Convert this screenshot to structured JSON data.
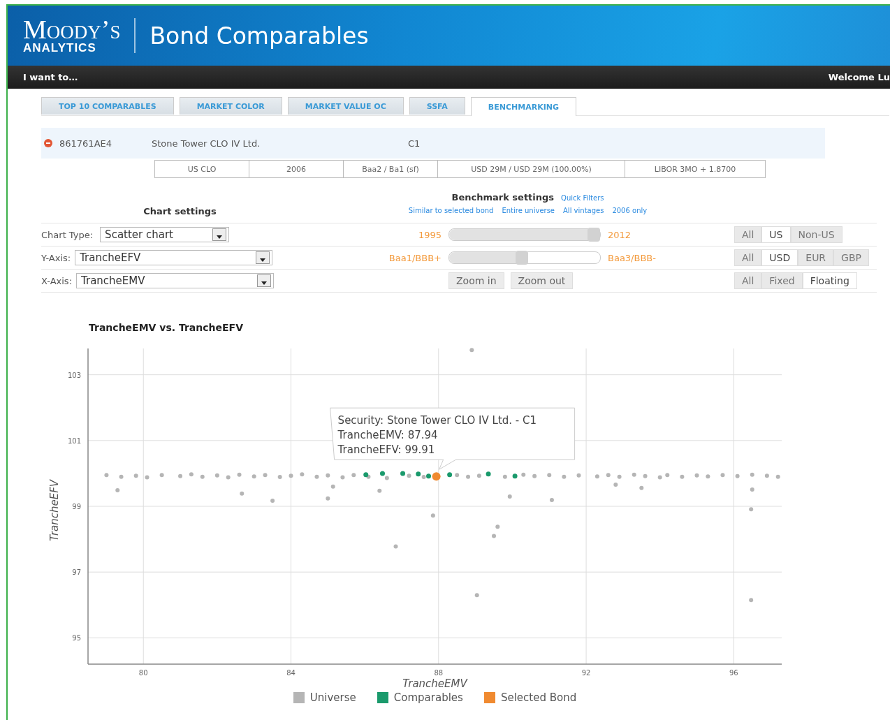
{
  "header": {
    "logo_name": "Moody’s",
    "logo_sub": "ANALYTICS",
    "title": "Bond Comparables"
  },
  "nav_bar": {
    "menu": "I want to…",
    "welcome": "Welcome Lu"
  },
  "tabs": [
    {
      "label": "TOP 10 COMPARABLES",
      "selected": false
    },
    {
      "label": "MARKET COLOR",
      "selected": false
    },
    {
      "label": "MARKET VALUE OC",
      "selected": false
    },
    {
      "label": "SSFA",
      "selected": false
    },
    {
      "label": "BENCHMARKING",
      "selected": true
    }
  ],
  "bond": {
    "cusip": "861761AE4",
    "name": "Stone Tower CLO IV Ltd.",
    "tranche": "C1",
    "details": [
      "US CLO",
      "2006",
      "Baa2 / Ba1 (sf)",
      "USD 29M / USD 29M (100.00%)",
      "LIBOR 3MO + 1.8700"
    ]
  },
  "chart_settings": {
    "heading": "Chart settings",
    "rows": [
      {
        "label": "Chart Type:",
        "value": "Scatter chart"
      },
      {
        "label": "Y-Axis:",
        "value": "TrancheEFV"
      },
      {
        "label": "X-Axis:",
        "value": "TrancheEMV"
      }
    ]
  },
  "benchmark_settings": {
    "heading": "Benchmark settings",
    "quick_filters": "Quick Filters",
    "links": [
      "Similar to selected bond",
      "Entire universe",
      "All vintages",
      "2006 only"
    ],
    "sliders": [
      {
        "min_label": "1995",
        "max_label": "2012",
        "level": 1.0
      },
      {
        "min_label": "Baa1/BBB+",
        "max_label": "Baa3/BBB-",
        "level": 0.48
      }
    ],
    "zoom_buttons": [
      "Zoom in",
      "Zoom out"
    ],
    "filters": [
      [
        {
          "label": "All",
          "selected": false
        },
        {
          "label": "US",
          "selected": true
        },
        {
          "label": "Non-US",
          "selected": false
        }
      ],
      [
        {
          "label": "All",
          "selected": false
        },
        {
          "label": "USD",
          "selected": true
        },
        {
          "label": "EUR",
          "selected": false
        },
        {
          "label": "GBP",
          "selected": false
        }
      ],
      [
        {
          "label": "All",
          "selected": false
        },
        {
          "label": "Fixed",
          "selected": false
        },
        {
          "label": "Floating",
          "selected": true
        }
      ]
    ]
  },
  "chart": {
    "tooltip": [
      "Security: Stone Tower CLO IV Ltd. - C1",
      "TrancheEMV: 87.94",
      "TrancheEFV: 99.91"
    ],
    "chart_data": {
      "type": "scatter",
      "grid": true,
      "legend": "bottom",
      "title": "TrancheEMV vs. TrancheEFV",
      "xlabel": "TrancheEMV",
      "ylabel": "TrancheEFV",
      "xlim": [
        78.5,
        97.3
      ],
      "ylim": [
        94.2,
        103.8
      ],
      "xticks": [
        80,
        84,
        88,
        92,
        96
      ],
      "yticks": [
        95,
        97,
        99,
        101,
        103
      ],
      "series": [
        {
          "name": "Universe",
          "color": "#b5b5b5",
          "x": [
            79.0,
            79.4,
            79.8,
            80.1,
            80.5,
            81.0,
            81.3,
            81.6,
            82.0,
            82.3,
            82.6,
            83.0,
            83.3,
            83.7,
            84.0,
            84.3,
            84.7,
            85.0,
            85.4,
            85.7,
            86.1,
            86.6,
            87.2,
            87.6,
            88.5,
            88.8,
            89.1,
            89.8,
            90.3,
            90.6,
            91.0,
            91.4,
            91.8,
            92.3,
            92.6,
            92.9,
            93.3,
            93.6,
            94.0,
            94.2,
            94.6,
            95.0,
            95.3,
            95.7,
            96.1,
            96.5,
            96.9,
            97.2,
            79.3,
            82.67,
            83.5,
            85.0,
            85.14,
            86.4,
            86.84,
            87.85,
            88.9,
            89.04,
            89.5,
            89.6,
            89.93,
            91.07,
            92.8,
            93.5,
            96.47,
            96.47,
            96.5
          ],
          "values": [
            99.95,
            99.9,
            99.93,
            99.88,
            99.95,
            99.92,
            99.97,
            99.9,
            99.94,
            99.88,
            99.96,
            99.91,
            99.95,
            99.89,
            99.93,
            99.97,
            99.9,
            99.94,
            99.88,
            99.95,
            99.9,
            99.86,
            99.93,
            99.89,
            99.95,
            99.9,
            99.93,
            99.9,
            99.96,
            99.92,
            99.95,
            99.9,
            99.94,
            99.91,
            99.95,
            99.9,
            99.96,
            99.92,
            99.88,
            99.95,
            99.9,
            99.94,
            99.91,
            99.95,
            99.92,
            99.96,
            99.93,
            99.9,
            99.49,
            99.39,
            99.17,
            99.24,
            99.6,
            99.47,
            97.78,
            98.72,
            103.75,
            96.3,
            98.1,
            98.38,
            99.3,
            99.19,
            99.66,
            99.56,
            98.91,
            96.15,
            99.51
          ]
        },
        {
          "name": "Comparables",
          "color": "#1a9a6c",
          "x": [
            86.03,
            86.48,
            87.03,
            87.45,
            87.73,
            88.3,
            89.35,
            90.07
          ],
          "values": [
            99.96,
            100.0,
            100.0,
            99.98,
            99.92,
            99.96,
            99.98,
            99.92
          ]
        },
        {
          "name": "Selected Bond",
          "color": "#f08a30",
          "x": [
            87.94
          ],
          "values": [
            99.91
          ]
        }
      ]
    }
  }
}
